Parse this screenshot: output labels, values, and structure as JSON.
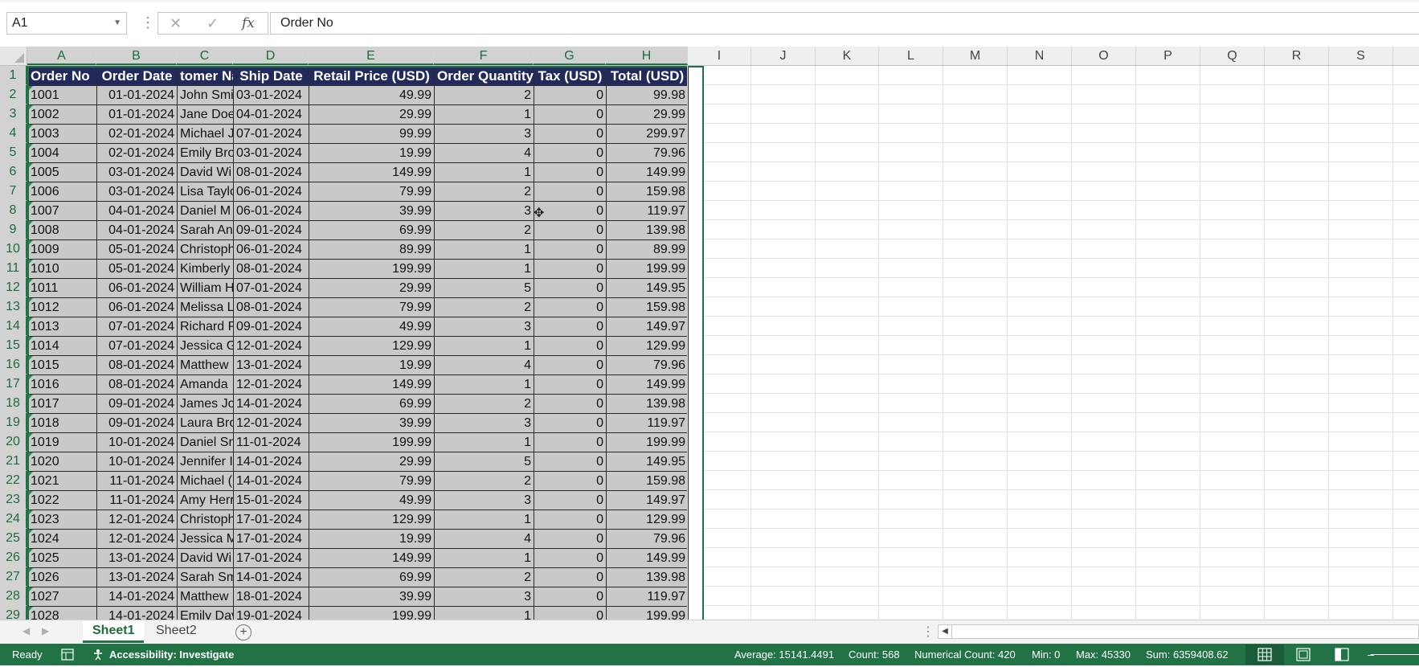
{
  "name_box": "A1",
  "formula_value": "Order No",
  "formula_buttons": {
    "cancel": "✕",
    "enter": "✓",
    "fx": "fx"
  },
  "columns": [
    "A",
    "B",
    "C",
    "D",
    "E",
    "F",
    "G",
    "H",
    "I",
    "J",
    "K",
    "L",
    "M",
    "N",
    "O",
    "P",
    "Q",
    "R",
    "S"
  ],
  "row_numbers": [
    "1",
    "2",
    "3",
    "4",
    "5",
    "6",
    "7",
    "8",
    "9",
    "10",
    "11",
    "12",
    "13",
    "14",
    "15",
    "16",
    "17",
    "18",
    "19",
    "20",
    "21",
    "22",
    "23",
    "24",
    "25",
    "26",
    "27",
    "28",
    "29"
  ],
  "table": {
    "headers": [
      "Order No",
      "Order Date",
      "tomer Na",
      "Ship Date",
      "Retail Price (USD)",
      "Order Quantity",
      "Tax (USD)",
      "Total (USD)"
    ],
    "rows": [
      [
        "1001",
        "01-01-2024",
        "John Smi",
        "03-01-2024",
        "49.99",
        "2",
        "0",
        "99.98"
      ],
      [
        "1002",
        "01-01-2024",
        "Jane Doe",
        "04-01-2024",
        "29.99",
        "1",
        "0",
        "29.99"
      ],
      [
        "1003",
        "02-01-2024",
        "Michael J",
        "07-01-2024",
        "99.99",
        "3",
        "0",
        "299.97"
      ],
      [
        "1004",
        "02-01-2024",
        "Emily Bro",
        "03-01-2024",
        "19.99",
        "4",
        "0",
        "79.96"
      ],
      [
        "1005",
        "03-01-2024",
        "David Wi",
        "08-01-2024",
        "149.99",
        "1",
        "0",
        "149.99"
      ],
      [
        "1006",
        "03-01-2024",
        "Lisa Taylo",
        "06-01-2024",
        "79.99",
        "2",
        "0",
        "159.98"
      ],
      [
        "1007",
        "04-01-2024",
        "Daniel M",
        "06-01-2024",
        "39.99",
        "3",
        "0",
        "119.97"
      ],
      [
        "1008",
        "04-01-2024",
        "Sarah An",
        "09-01-2024",
        "69.99",
        "2",
        "0",
        "139.98"
      ],
      [
        "1009",
        "05-01-2024",
        "Christoph",
        "06-01-2024",
        "89.99",
        "1",
        "0",
        "89.99"
      ],
      [
        "1010",
        "05-01-2024",
        "Kimberly",
        "08-01-2024",
        "199.99",
        "1",
        "0",
        "199.99"
      ],
      [
        "1011",
        "06-01-2024",
        "William H",
        "07-01-2024",
        "29.99",
        "5",
        "0",
        "149.95"
      ],
      [
        "1012",
        "06-01-2024",
        "Melissa L",
        "08-01-2024",
        "79.99",
        "2",
        "0",
        "159.98"
      ],
      [
        "1013",
        "07-01-2024",
        "Richard P",
        "09-01-2024",
        "49.99",
        "3",
        "0",
        "149.97"
      ],
      [
        "1014",
        "07-01-2024",
        "Jessica G",
        "12-01-2024",
        "129.99",
        "1",
        "0",
        "129.99"
      ],
      [
        "1015",
        "08-01-2024",
        "Matthew",
        "13-01-2024",
        "19.99",
        "4",
        "0",
        "79.96"
      ],
      [
        "1016",
        "08-01-2024",
        "Amanda",
        "12-01-2024",
        "149.99",
        "1",
        "0",
        "149.99"
      ],
      [
        "1017",
        "09-01-2024",
        "James Jo",
        "14-01-2024",
        "69.99",
        "2",
        "0",
        "139.98"
      ],
      [
        "1018",
        "09-01-2024",
        "Laura Bro",
        "12-01-2024",
        "39.99",
        "3",
        "0",
        "119.97"
      ],
      [
        "1019",
        "10-01-2024",
        "Daniel Sn",
        "11-01-2024",
        "199.99",
        "1",
        "0",
        "199.99"
      ],
      [
        "1020",
        "10-01-2024",
        "Jennifer I",
        "14-01-2024",
        "29.99",
        "5",
        "0",
        "149.95"
      ],
      [
        "1021",
        "11-01-2024",
        "Michael (",
        "14-01-2024",
        "79.99",
        "2",
        "0",
        "159.98"
      ],
      [
        "1022",
        "11-01-2024",
        "Amy Herr",
        "15-01-2024",
        "49.99",
        "3",
        "0",
        "149.97"
      ],
      [
        "1023",
        "12-01-2024",
        "Christoph",
        "17-01-2024",
        "129.99",
        "1",
        "0",
        "129.99"
      ],
      [
        "1024",
        "12-01-2024",
        "Jessica M",
        "17-01-2024",
        "19.99",
        "4",
        "0",
        "79.96"
      ],
      [
        "1025",
        "13-01-2024",
        "David Wi",
        "17-01-2024",
        "149.99",
        "1",
        "0",
        "149.99"
      ],
      [
        "1026",
        "13-01-2024",
        "Sarah Sm",
        "14-01-2024",
        "69.99",
        "2",
        "0",
        "139.98"
      ],
      [
        "1027",
        "14-01-2024",
        "Matthew",
        "18-01-2024",
        "39.99",
        "3",
        "0",
        "119.97"
      ],
      [
        "1028",
        "14-01-2024",
        "Emily Day",
        "19-01-2024",
        "199.99",
        "1",
        "0",
        "199.99"
      ]
    ]
  },
  "sheets": {
    "tab1": "Sheet1",
    "tab2": "Sheet2",
    "add": "+"
  },
  "status": {
    "ready": "Ready",
    "accessibility": "Accessibility: Investigate",
    "average": "Average: 15141.4491",
    "count": "Count: 568",
    "numerical_count": "Numerical Count: 420",
    "min": "Min: 0",
    "max": "Max: 45330",
    "sum": "Sum: 6359408.62"
  },
  "colors": {
    "header_fill": "#222a5c",
    "cell_fill": "#c9c9c9",
    "accent": "#217346"
  }
}
